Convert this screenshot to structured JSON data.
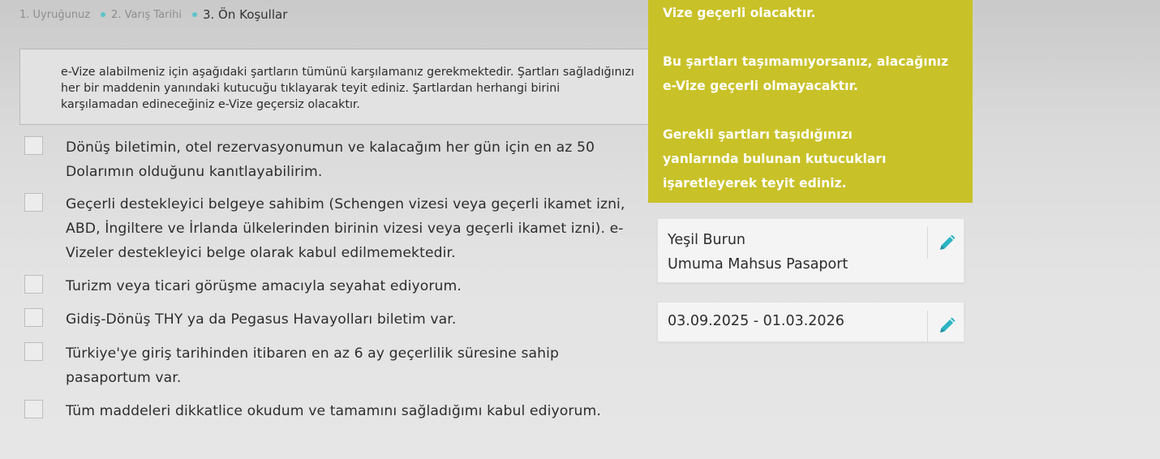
{
  "breadcrumb": {
    "steps": [
      {
        "label": "1. Uyruğunuz"
      },
      {
        "label": "2. Varış Tarihi"
      },
      {
        "label": "3. Ön Koşullar"
      }
    ]
  },
  "notice": {
    "text": "e-Vize alabilmeniz için aşağıdaki şartların tümünü karşılamanız gerekmektedir. Şartları sağladığınızı her bir maddenin yanındaki kutucuğu tıklayarak teyit ediniz. Şartlardan herhangi birini karşılamadan edineceğiniz e-Vize geçersiz olacaktır."
  },
  "checklist": {
    "items": [
      {
        "label": "Dönüş biletimin, otel rezervasyonumun ve kalacağım her gün için en az 50 Dolarımın olduğunu kanıtlayabilirim.",
        "checked": false
      },
      {
        "label": "Geçerli destekleyici belgeye sahibim (Schengen vizesi veya geçerli ikamet izni, ABD, İngiltere ve İrlanda ülkelerinden birinin vizesi veya geçerli ikamet izni). e-Vizeler destekleyici belge olarak kabul edilmemektedir.",
        "checked": false
      },
      {
        "label": "Turizm veya ticari görüşme amacıyla seyahat ediyorum.",
        "checked": false
      },
      {
        "label": "Gidiş-Dönüş THY ya da Pegasus Havayolları biletim var.",
        "checked": false
      },
      {
        "label": "Türkiye'ye giriş tarihinden itibaren en az 6 ay geçerlilik süresine sahip pasaportum var.",
        "checked": false
      },
      {
        "label": "Tüm maddeleri dikkatlice okudum ve tamamını sağladığımı kabul ediyorum.",
        "checked": false
      }
    ]
  },
  "info_panel": {
    "paragraph_1": "Vize geçerli olacaktır.",
    "paragraph_2": "Bu şartları taşımamıyorsanız, alacağınız e-Vize geçerli olmayacaktır.",
    "paragraph_3": "Gerekli şartları taşıdığınızı yanlarında bulunan kutucukları işaretleyerek teyit ediniz.",
    "background": "#c9c128"
  },
  "summary": {
    "nationality_card": {
      "country": "Yeşil Burun",
      "passport_type": "Umuma Mahsus Pasaport"
    },
    "date_card": {
      "date_range": "03.09.2025 - 01.03.2026"
    },
    "edit_icon": "pencil-icon",
    "accent": "#2bb4c4"
  }
}
